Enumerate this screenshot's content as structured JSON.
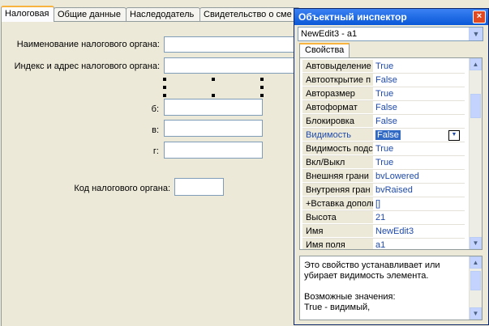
{
  "tabs": [
    "Налоговая",
    "Общие данные",
    "Наследодатель",
    "Свидетельство о сме"
  ],
  "form": {
    "tax_name_label": "Наименование налогового органа:",
    "tax_addr_label": "Индекс и адрес налогового органа:",
    "b_label": "б:",
    "v_label": "в:",
    "g_label": "г:",
    "code_label": "Код налогового органа:"
  },
  "inspector": {
    "title": "Объектный инспектор",
    "close": "×",
    "object": "NewEdit3 - a1",
    "tab": "Свойства",
    "properties": [
      {
        "name": "Автовыделение",
        "value": "True"
      },
      {
        "name": "Автооткрытие п",
        "value": "False"
      },
      {
        "name": "Авторазмер",
        "value": "True"
      },
      {
        "name": "Автоформат",
        "value": "False"
      },
      {
        "name": "Блокировка",
        "value": "False"
      },
      {
        "name": "Видимость",
        "value": "False"
      },
      {
        "name": "Видимость подс",
        "value": "True"
      },
      {
        "name": "Вкл/Выкл",
        "value": "True"
      },
      {
        "name": "Внешняя грани",
        "value": "bvLowered"
      },
      {
        "name": "Внутреняя гран",
        "value": "bvRaised"
      },
      {
        "name": "+Вставка дополн",
        "value": "[]"
      },
      {
        "name": "Высота",
        "value": "21"
      },
      {
        "name": "Имя",
        "value": "NewEdit3"
      },
      {
        "name": "Имя поля",
        "value": "a1"
      }
    ],
    "help_lines": [
      "Это свойство устанавливает или",
      "убирает видимость элемента.",
      "",
      "Возможные значения:",
      "True - видимый,"
    ]
  }
}
